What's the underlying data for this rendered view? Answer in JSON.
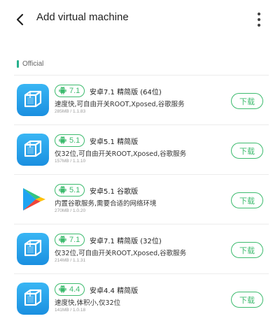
{
  "header": {
    "title": "Add virtual machine",
    "back_icon": "back-arrow-icon",
    "more_icon": "more-vertical-icon"
  },
  "section": {
    "label": "Official"
  },
  "colors": {
    "accent": "#3dbb6e",
    "section_bar": "#26b08c"
  },
  "items": [
    {
      "version": "7.1",
      "name": "安卓7.1 精简版 (64位)",
      "desc": "速度快,可自由开关ROOT,Xposed,谷歌服务",
      "meta": "285MB / 1.1.83",
      "icon": "vm-cube-icon",
      "button": "下载"
    },
    {
      "version": "5.1",
      "name": "安卓5.1 精简版",
      "desc": "仅32位,可自由开关ROOT,Xposed,谷歌服务",
      "meta": "157MB / 1.1.10",
      "icon": "vm-cube-icon",
      "button": "下载"
    },
    {
      "version": "5.1",
      "name": "安卓5.1 谷歌版",
      "desc": "内置谷歌服务,需要合适的网络环境",
      "meta": "270MB / 1.0.20",
      "icon": "google-play-icon",
      "button": "下载"
    },
    {
      "version": "7.1",
      "name": "安卓7.1 精简版 (32位)",
      "desc": "仅32位,可自由开关ROOT,Xposed,谷歌服务",
      "meta": "214MB / 1.1.31",
      "icon": "vm-cube-icon",
      "button": "下载"
    },
    {
      "version": "4.4",
      "name": "安卓4.4 精简版",
      "desc": "速度快,体积小,仅32位",
      "meta": "141MB / 1.0.18",
      "icon": "vm-cube-icon",
      "button": "下载"
    }
  ]
}
